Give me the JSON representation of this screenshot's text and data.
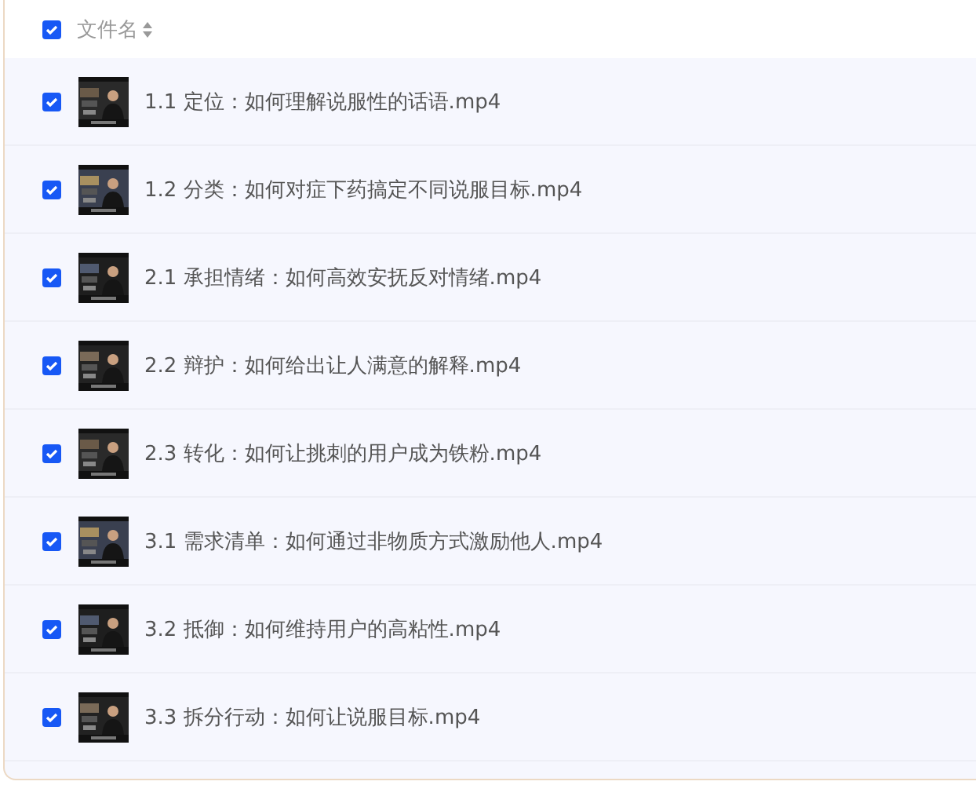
{
  "header": {
    "checked": true,
    "label": "文件名"
  },
  "files": [
    {
      "name": "1.1 定位：如何理解说服性的话语.mp4",
      "checked": true,
      "kind": "picture"
    },
    {
      "name": "1.2 分类：如何对症下药搞定不同说服目标.mp4",
      "checked": true,
      "kind": "picture"
    },
    {
      "name": "2.1 承担情绪：如何高效安抚反对情绪.mp4",
      "checked": true,
      "kind": "picture"
    },
    {
      "name": "2.2 辩护：如何给出让人满意的解释.mp4",
      "checked": true,
      "kind": "picture"
    },
    {
      "name": "2.3 转化：如何让挑刺的用户成为铁粉.mp4",
      "checked": true,
      "kind": "picture"
    },
    {
      "name": "3.1 需求清单：如何通过非物质方式激励他人.mp4",
      "checked": true,
      "kind": "picture"
    },
    {
      "name": "3.2 抵御：如何维持用户的高粘性.mp4",
      "checked": true,
      "kind": "picture"
    },
    {
      "name": "3.3 拆分行动：如何让说服目标.mp4",
      "checked": true,
      "kind": "picture"
    }
  ]
}
